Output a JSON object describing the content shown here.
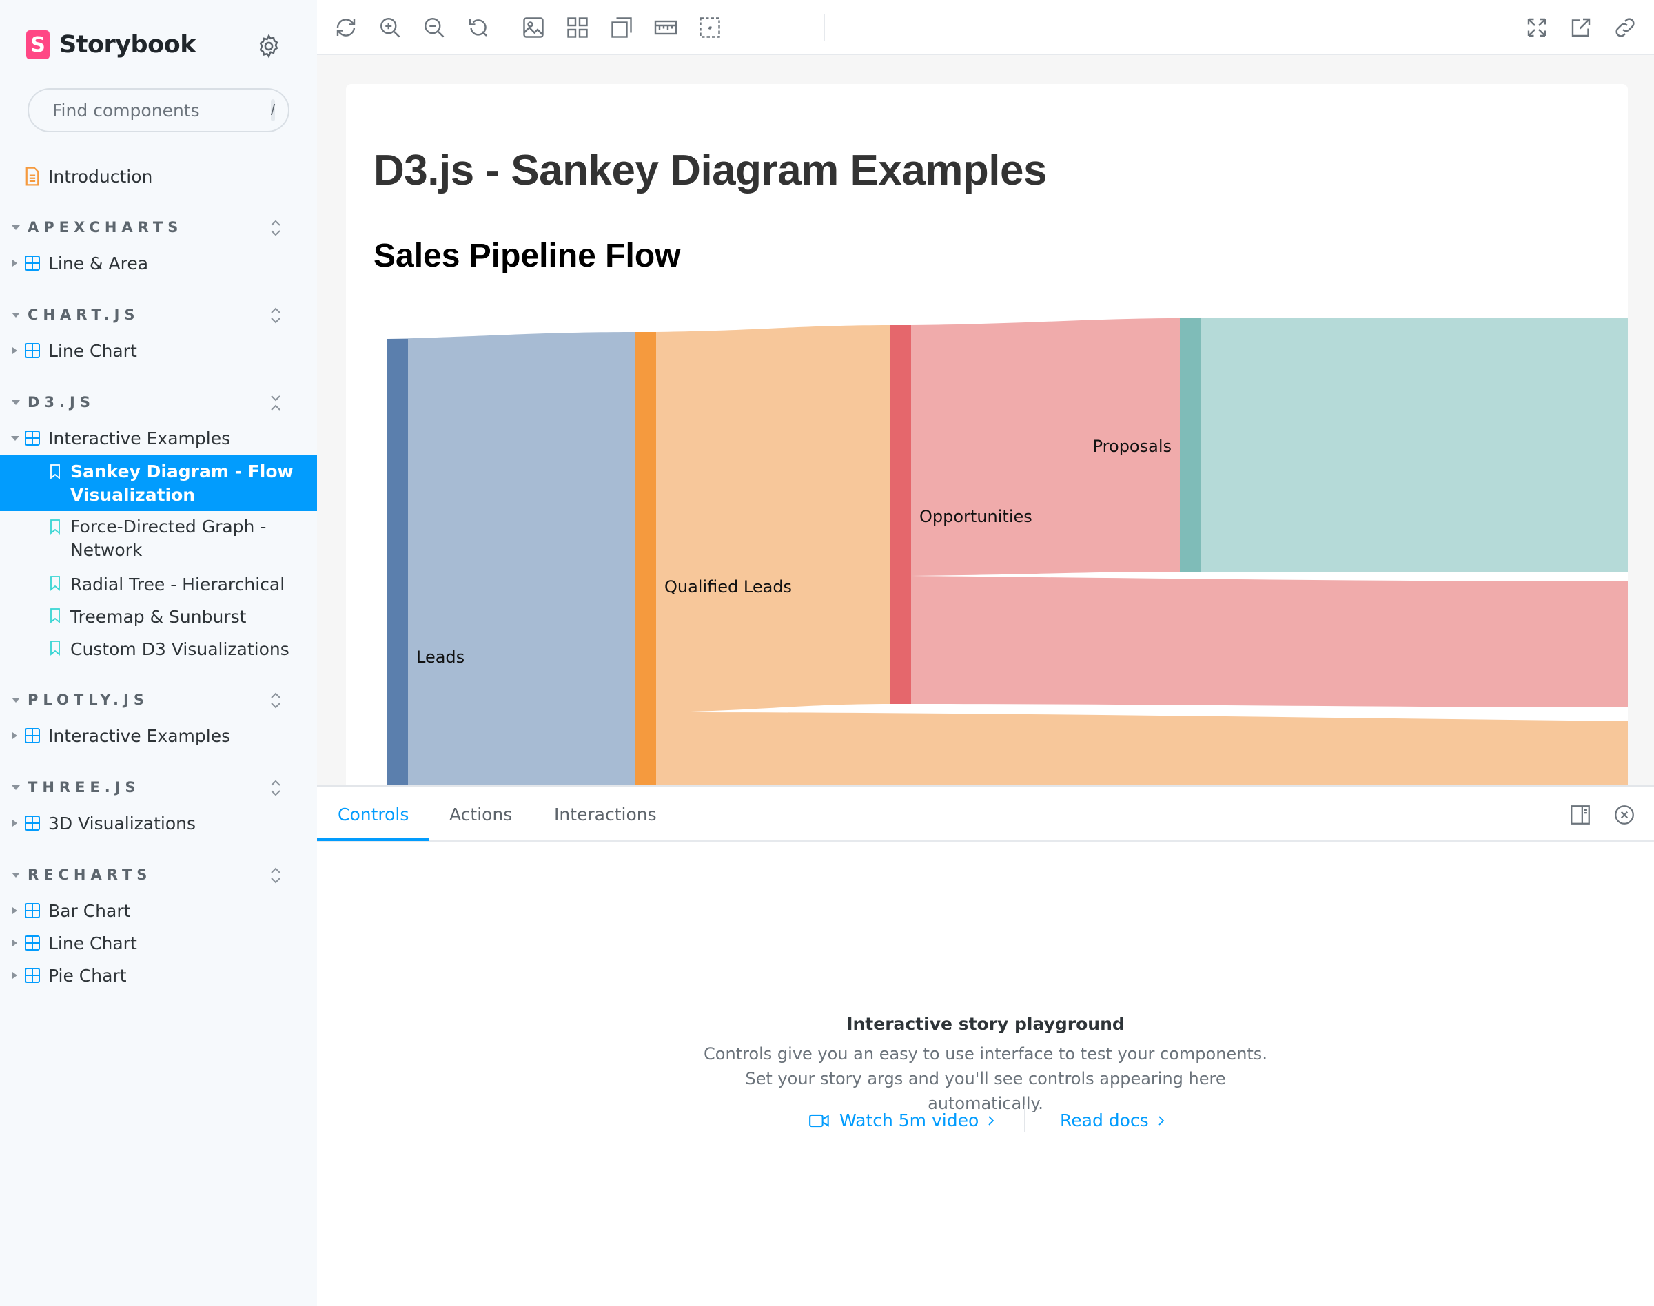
{
  "app": {
    "name": "Storybook",
    "logo_letter": "S"
  },
  "search": {
    "placeholder": "Find components",
    "shortcut": "/"
  },
  "sidebar": {
    "intro": "Introduction",
    "sections": [
      {
        "title": "APEXCHARTS",
        "items": [
          "Line & Area"
        ]
      },
      {
        "title": "CHART.JS",
        "items": [
          "Line Chart"
        ]
      },
      {
        "title": "D3.JS",
        "group": "Interactive Examples",
        "stories": [
          {
            "line1": "Sankey Diagram - Flow",
            "line2": "Visualization"
          },
          {
            "line1": "Force-Directed Graph -",
            "line2": "Network"
          },
          {
            "line1": "Radial Tree - Hierarchical"
          },
          {
            "line1": "Treemap & Sunburst"
          },
          {
            "line1": "Custom D3 Visualizations"
          }
        ]
      },
      {
        "title": "PLOTLY.JS",
        "items": [
          "Interactive Examples"
        ]
      },
      {
        "title": "THREE.JS",
        "items": [
          "3D Visualizations"
        ]
      },
      {
        "title": "RECHARTS",
        "items": [
          "Bar Chart",
          "Line Chart",
          "Pie Chart"
        ]
      }
    ]
  },
  "doc": {
    "title": "D3.js - Sankey Diagram Examples",
    "subtitle": "Sales Pipeline Flow"
  },
  "chart_data": {
    "type": "sankey",
    "nodes": [
      {
        "label": "Leads",
        "color": "#5b7fad"
      },
      {
        "label": "Qualified Leads",
        "color": "#f59a3e"
      },
      {
        "label": "Opportunities",
        "color": "#e5676c"
      },
      {
        "label": "Proposals",
        "color": "#7fbcb8"
      }
    ]
  },
  "panel": {
    "tabs": [
      "Controls",
      "Actions",
      "Interactions"
    ],
    "empty_title": "Interactive story playground",
    "empty_desc": "Controls give you an easy to use interface to test your components. Set your story args and you'll see controls appearing here automatically.",
    "link_video": "Watch 5m video",
    "link_docs": "Read docs"
  },
  "colors": {
    "accent": "#029cfd",
    "brand": "#ff4785"
  }
}
